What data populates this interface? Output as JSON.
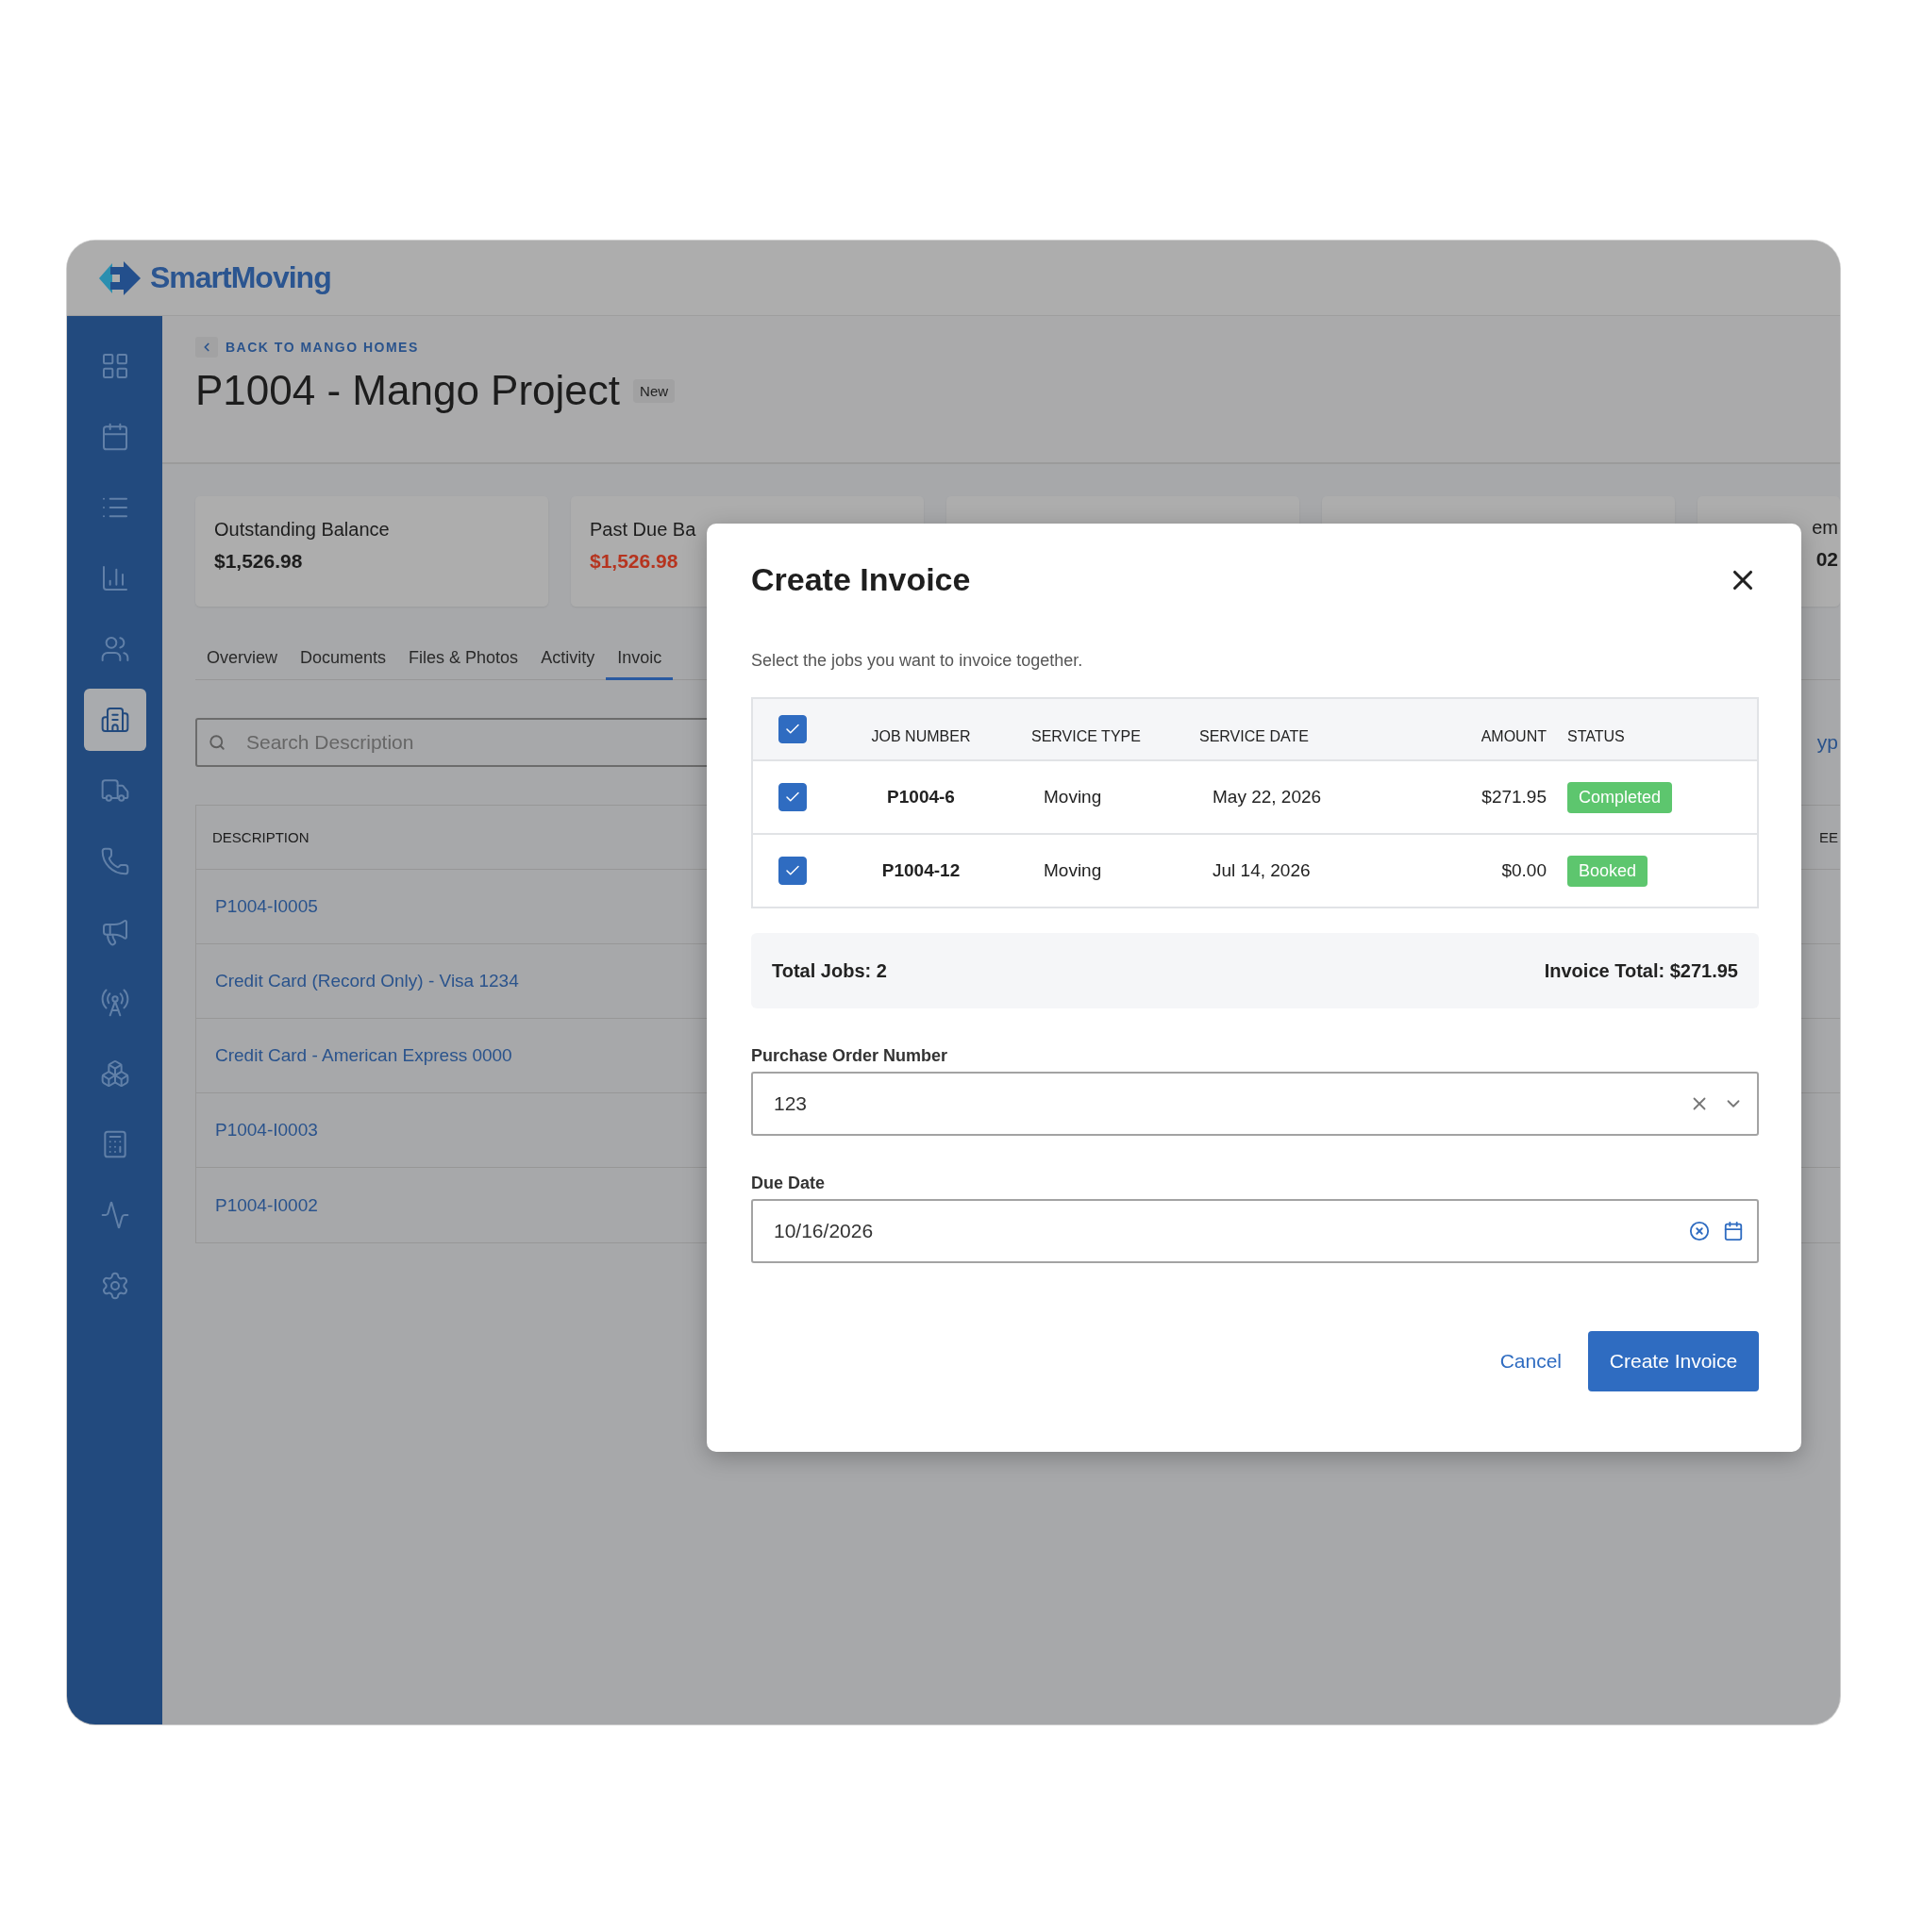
{
  "app": {
    "logo_text": "SmartMoving"
  },
  "sidebar": {
    "items": [
      {
        "selected": false
      },
      {
        "selected": false
      },
      {
        "selected": false
      },
      {
        "selected": false
      },
      {
        "selected": false
      },
      {
        "selected": true
      },
      {
        "selected": false
      },
      {
        "selected": false
      },
      {
        "selected": false
      },
      {
        "selected": false
      },
      {
        "selected": false
      },
      {
        "selected": false
      },
      {
        "selected": false
      },
      {
        "selected": false
      }
    ]
  },
  "page": {
    "breadcrumb": "BACK TO MANGO HOMES",
    "title": "P1004 - Mango Project",
    "badge": "New"
  },
  "summary_cards": [
    {
      "label": "Outstanding Balance",
      "value": "$1,526.98",
      "kind": "normal"
    },
    {
      "label": "Past Due Ba",
      "value": "$1,526.98",
      "kind": "alert"
    },
    {
      "kind": "empty"
    },
    {
      "kind": "empty"
    },
    {
      "label": "em",
      "value": "02",
      "kind": "normal"
    }
  ],
  "tabs": [
    {
      "label": "Overview",
      "selected": false
    },
    {
      "label": "Documents",
      "selected": false
    },
    {
      "label": "Files & Photos",
      "selected": false
    },
    {
      "label": "Activity",
      "selected": false
    },
    {
      "label": "Invoic",
      "selected": true
    }
  ],
  "search": {
    "placeholder": "Search Description",
    "link_fragment": "yp"
  },
  "table": {
    "columns": [
      "DESCRIPTION",
      "EE"
    ],
    "rows": [
      "P1004-I0005",
      "Credit Card (Record Only) - Visa 1234",
      "Credit Card - American Express 0000",
      "P1004-I0003",
      "P1004-I0002"
    ]
  },
  "dialog": {
    "title": "Create Invoice",
    "subtitle": "Select the jobs you want to invoice together.",
    "all_selected": true,
    "columns": [
      "JOB NUMBER",
      "SERVICE TYPE",
      "SERVICE DATE",
      "AMOUNT",
      "STATUS"
    ],
    "jobs": [
      {
        "job_number": "P1004-6",
        "service_type": "Moving",
        "service_date": "May 22, 2026",
        "amount": "$271.95",
        "status": "Completed",
        "selected": true
      },
      {
        "job_number": "P1004-12",
        "service_type": "Moving",
        "service_date": "Jul 14, 2026",
        "amount": "$0.00",
        "status": "Booked",
        "selected": true
      }
    ],
    "total_jobs": "Total Jobs: 2",
    "invoice_total": "Invoice Total: $271.95",
    "po_label": "Purchase Order Number",
    "po_value": "123",
    "due_label": "Due Date",
    "due_value": "10/16/2026",
    "cancel": "Cancel",
    "submit": "Create Invoice"
  }
}
